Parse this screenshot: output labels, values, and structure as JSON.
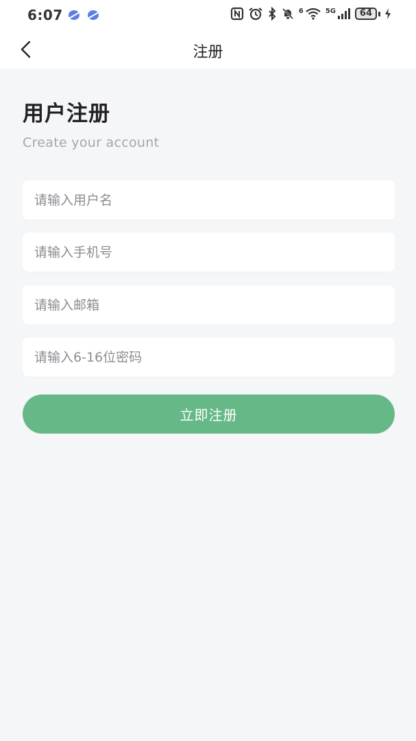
{
  "status_bar": {
    "time": "6:07",
    "signal_label": "5G",
    "wifi_label": "6",
    "battery": "64"
  },
  "nav": {
    "title": "注册",
    "back_icon": "chevron-left-icon"
  },
  "header": {
    "title": "用户注册",
    "subtitle": "Create your account"
  },
  "form": {
    "username_placeholder": "请输入用户名",
    "phone_placeholder": "请输入手机号",
    "email_placeholder": "请输入邮箱",
    "password_placeholder": "请输入6-16位密码",
    "submit_label": "立即注册"
  },
  "colors": {
    "accent": "#66b987",
    "background": "#f5f6f8",
    "subtitle": "#a3a6ab"
  }
}
